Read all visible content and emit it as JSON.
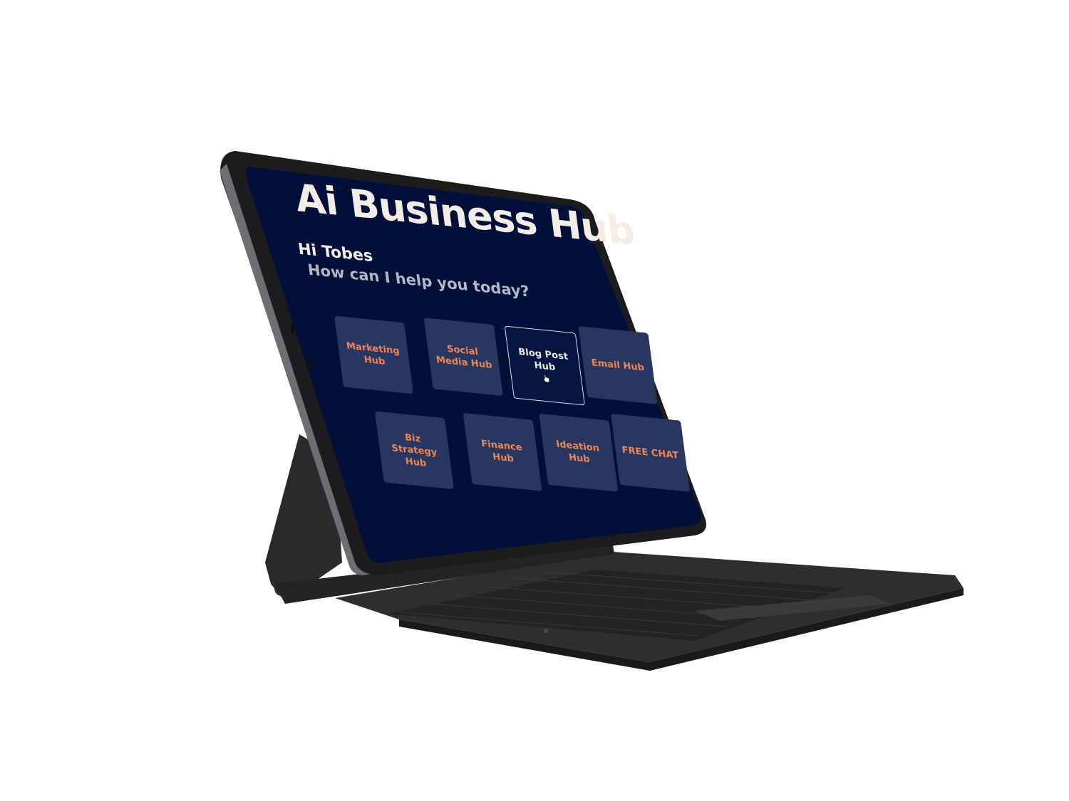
{
  "app": {
    "title": "Ai Business Hub",
    "greeting": "Hi Tobes",
    "prompt": "How can I help you today?"
  },
  "tiles": [
    {
      "label": "Marketing Hub",
      "active": false
    },
    {
      "label": "Social Media Hub",
      "active": false
    },
    {
      "label": "Blog Post Hub",
      "active": true
    },
    {
      "label": "Email Hub",
      "active": false
    },
    {
      "label": "Biz Strategy Hub",
      "active": false
    },
    {
      "label": "Finance Hub",
      "active": false
    },
    {
      "label": "Ideation Hub",
      "active": false
    },
    {
      "label": "FREE CHAT",
      "active": false
    }
  ],
  "colors": {
    "screen_bg": "#011038",
    "tile_bg": "#283760",
    "tile_text": "#ef8556",
    "title_text": "#f4ede6",
    "prompt_text": "#b4b8c4",
    "device_frame": "#1c1c1e",
    "keyboard": "#2b2b2d"
  },
  "device": {
    "type": "tablet-with-keyboard",
    "cursor_icon": "hand-pointer-icon"
  }
}
